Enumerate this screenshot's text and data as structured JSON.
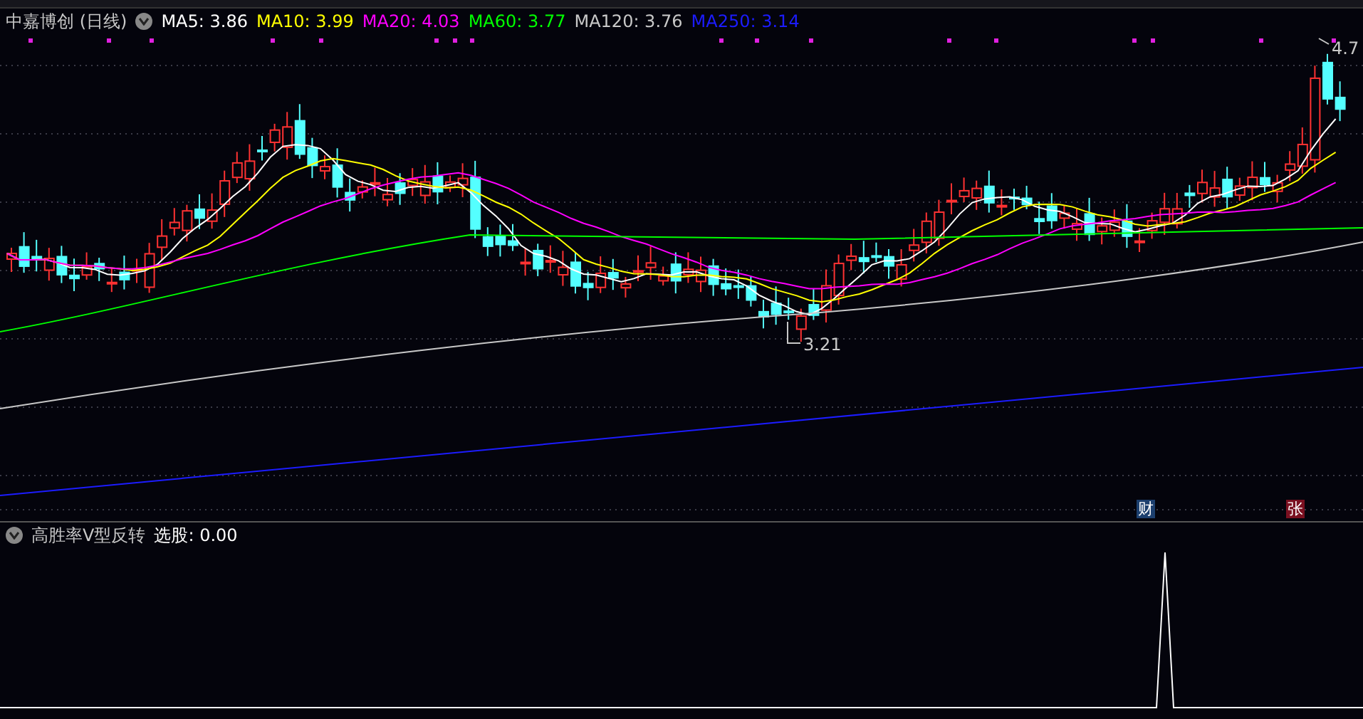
{
  "chart_header": {
    "stock": "中嘉博创 (日线)",
    "moving_averages": [
      {
        "label": "MA5: 3.86",
        "color": "#ffffff"
      },
      {
        "label": "MA10: 3.99",
        "color": "#ffff00"
      },
      {
        "label": "MA20: 4.03",
        "color": "#ff00ff"
      },
      {
        "label": "MA60: 3.77",
        "color": "#00ff00"
      },
      {
        "label": "MA120: 3.76",
        "color": "#c8c8c8"
      },
      {
        "label": "MA250: 3.14",
        "color": "#1c1cff"
      }
    ]
  },
  "price_labels": [
    {
      "kind": "low",
      "label": "3.21"
    },
    {
      "kind": "high",
      "label": "4.7"
    }
  ],
  "event_badges": [
    {
      "label": "财",
      "color": "#1c3f6e"
    },
    {
      "label": "张",
      "color": "#7a1020"
    }
  ],
  "indicator": {
    "title": "高胜率V型反转",
    "value": "选股: 0.00"
  }
}
